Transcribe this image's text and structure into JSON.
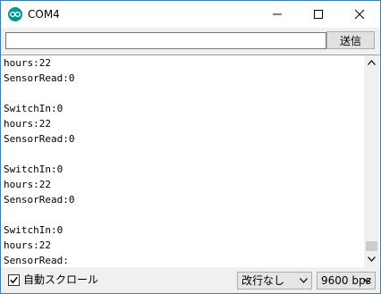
{
  "window": {
    "title": "COM4"
  },
  "send": {
    "input_value": "",
    "button_label": "送信"
  },
  "output": {
    "lines": [
      "hours:22",
      "SensorRead:0",
      "",
      "SwitchIn:0",
      "hours:22",
      "SensorRead:0",
      "",
      "SwitchIn:0",
      "hours:22",
      "SensorRead:0",
      "",
      "SwitchIn:0",
      "hours:22",
      "SensorRead:"
    ]
  },
  "footer": {
    "autoscroll_label": "自動スクロール",
    "autoscroll_checked": true,
    "line_ending": "改行なし",
    "baud_rate": "9600 bps"
  },
  "icons": {
    "app": "arduino-icon",
    "minimize": "minimize-icon",
    "maximize": "maximize-icon",
    "close": "close-icon",
    "scroll_up": "chevron-up-icon",
    "scroll_down": "chevron-down-icon",
    "checkbox": "checkmark-icon",
    "dropdown": "chevron-down-icon"
  },
  "colors": {
    "app_icon": "#00979c",
    "window_border": "#3c7fb1"
  }
}
